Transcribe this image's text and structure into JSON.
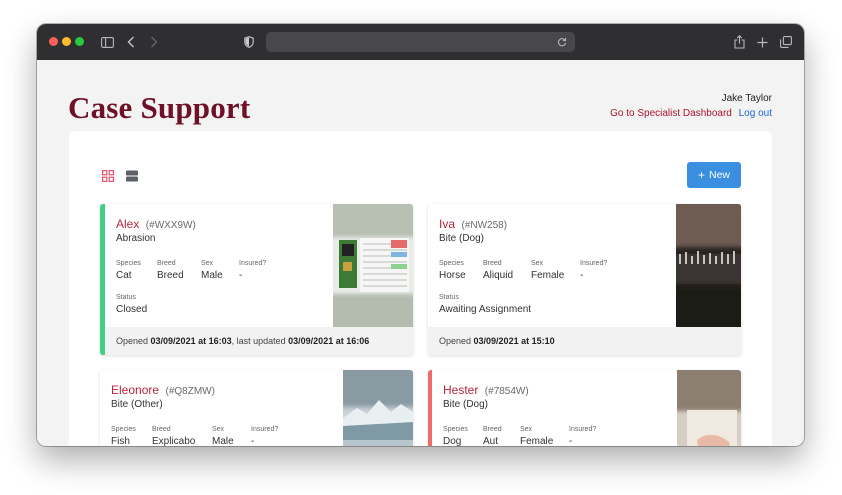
{
  "colors": {
    "brand": "#6e1126",
    "accent_red": "#b8253d",
    "new_button": "#3b8fe0",
    "closed_border": "#3fcf86",
    "alert_border": "#ef6a6a"
  },
  "browser": {
    "icons": [
      "sidebar-icon",
      "back-icon",
      "forward-icon",
      "privacy-shield-icon",
      "reload-icon",
      "share-icon",
      "new-tab-icon",
      "tabs-overview-icon"
    ]
  },
  "header": {
    "title": "Case Support",
    "user_name": "Jake Taylor",
    "specialist_link": "Go to Specialist Dashboard",
    "logout_link": "Log out"
  },
  "toolbar": {
    "new_label": "New",
    "view_modes": [
      "grid",
      "list"
    ],
    "active_view": "grid"
  },
  "labels": {
    "species": "Species",
    "breed": "Breed",
    "sex": "Sex",
    "insured": "Insured?",
    "status": "Status"
  },
  "cases": [
    {
      "name": "Alex",
      "id": "(#WXX9W)",
      "reason": "Abrasion",
      "species": "Cat",
      "breed": "Breed",
      "sex": "Male",
      "insured": "-",
      "status": "Closed",
      "footer_prefix": "Opened ",
      "opened": "03/09/2021 at 16:03",
      "footer_mid": ", last updated ",
      "updated": "03/09/2021 at 16:06"
    },
    {
      "name": "Iva",
      "id": "(#NW258)",
      "reason": "Bite (Dog)",
      "species": "Horse",
      "breed": "Aliquid",
      "sex": "Female",
      "insured": "-",
      "status": "Awaiting Assignment",
      "footer_prefix": "Opened ",
      "opened": "03/09/2021 at 15:10"
    },
    {
      "name": "Eleonore",
      "id": "(#Q8ZMW)",
      "reason": "Bite (Other)",
      "species": "Fish",
      "breed": "Explicabo",
      "sex": "Male",
      "insured": "-"
    },
    {
      "name": "Hester",
      "id": "(#7854W)",
      "reason": "Bite (Dog)",
      "species": "Dog",
      "breed": "Aut",
      "sex": "Female",
      "insured": "-"
    }
  ]
}
